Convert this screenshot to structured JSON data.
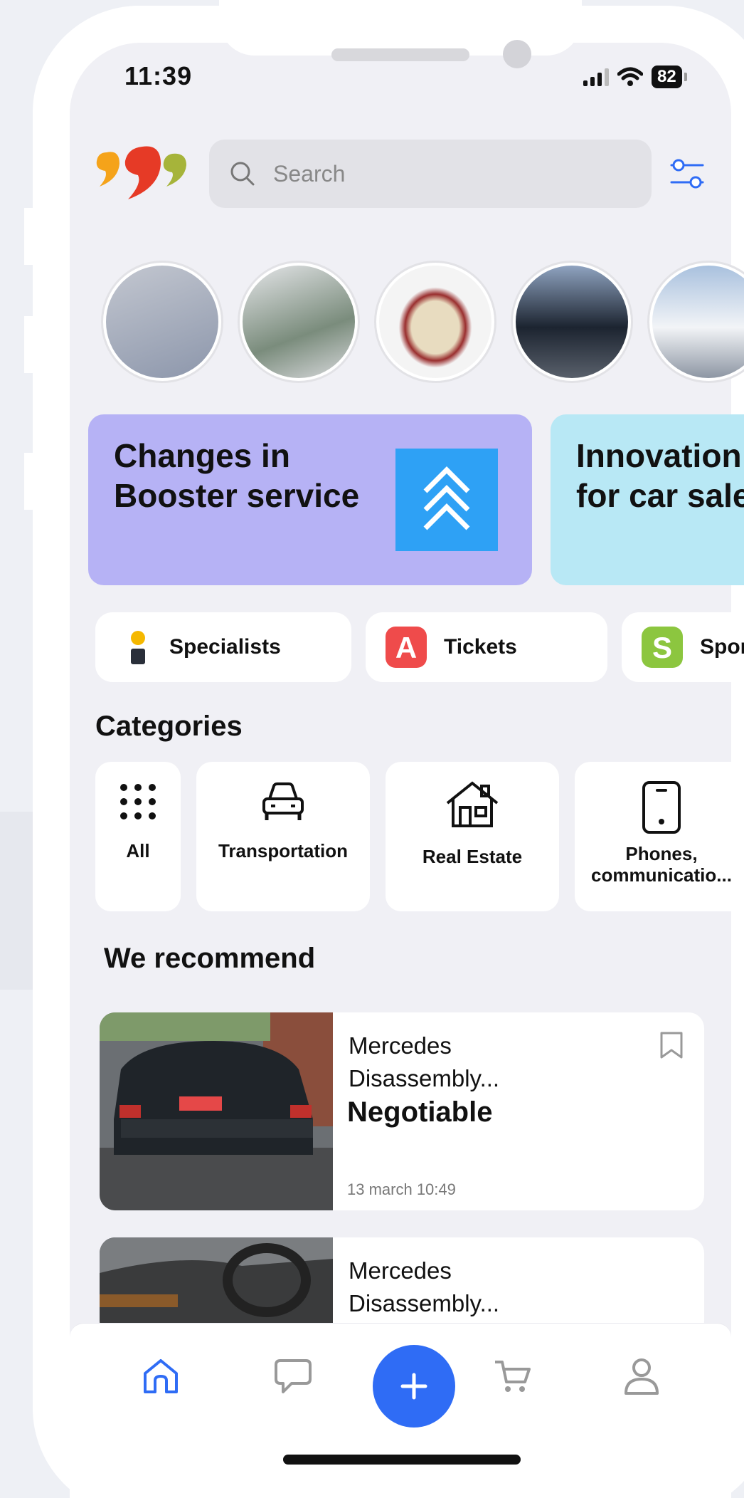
{
  "status_bar": {
    "time": "11:39",
    "battery": "82"
  },
  "search": {
    "placeholder": "Search"
  },
  "stories": [
    {
      "name": "phone-box-story",
      "color": "#9aa4b8"
    },
    {
      "name": "washing-machine-repair-story",
      "color": "#c9ccd2"
    },
    {
      "name": "massage-table-story",
      "color": "#d8c9a8"
    },
    {
      "name": "black-suv-story",
      "color": "#3c4c64"
    },
    {
      "name": "white-suv-story",
      "color": "#b7c3d2"
    }
  ],
  "banners": [
    {
      "line1": "Changes in",
      "line2": "Booster service",
      "bg": "#b6b2f5"
    },
    {
      "line1": "Innovation",
      "line2": "for car sale",
      "bg": "#b8e8f5"
    }
  ],
  "chips": [
    {
      "label": "Specialists",
      "icon": "specialist-icon"
    },
    {
      "label": "Tickets",
      "icon": "tickets-icon"
    },
    {
      "label": "Sport",
      "icon": "sport-icon"
    }
  ],
  "categories_title": "Categories",
  "categories": [
    {
      "label": "All",
      "icon": "grid-dots-icon"
    },
    {
      "label": "Transportation",
      "icon": "car-icon"
    },
    {
      "label": "Real Estate",
      "icon": "house-icon"
    },
    {
      "label": "Phones, communicatio...",
      "icon": "smartphone-icon"
    }
  ],
  "recommend_title": "We recommend",
  "listings": [
    {
      "title_line1": "Mercedes",
      "title_line2": "Disassembly...",
      "price": "Negotiable",
      "date": "13 march 10:49"
    },
    {
      "title_line1": "Mercedes",
      "title_line2": "Disassembly..."
    }
  ],
  "tabbar": [
    {
      "name": "home",
      "active": true
    },
    {
      "name": "messages"
    },
    {
      "name": "add"
    },
    {
      "name": "cart"
    },
    {
      "name": "profile"
    }
  ],
  "colors": {
    "accent": "#2f6cf5",
    "booster": "#2ea1f5",
    "logo_orange": "#f5a31a",
    "logo_red": "#e63a26",
    "logo_green": "#a6b43a"
  }
}
